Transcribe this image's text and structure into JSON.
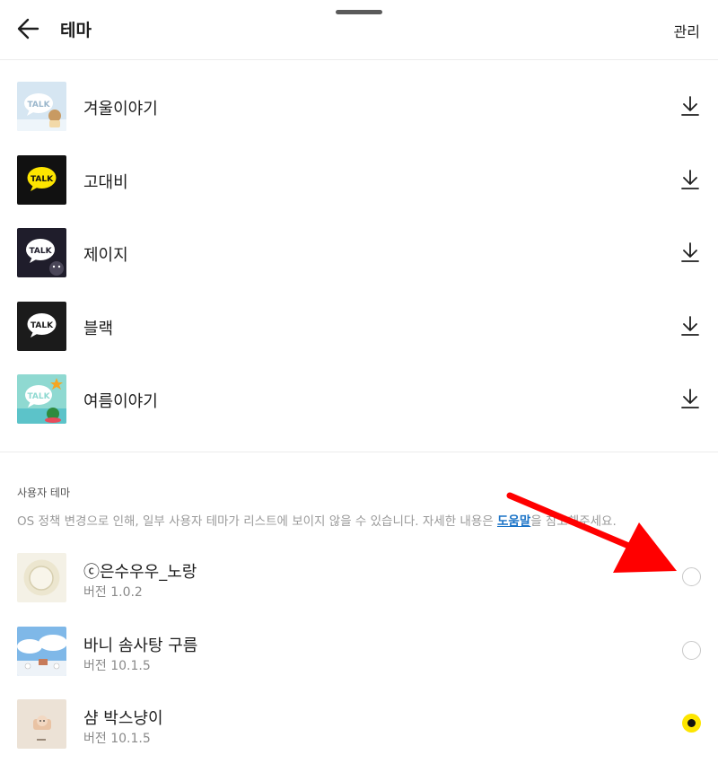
{
  "header": {
    "title": "테마",
    "manage_label": "관리"
  },
  "themes": [
    {
      "name": "겨울이야기",
      "thumb_label": "TALK",
      "style": "winter"
    },
    {
      "name": "고대비",
      "thumb_label": "TALK",
      "style": "highcontrast"
    },
    {
      "name": "제이지",
      "thumb_label": "TALK",
      "style": "jayg"
    },
    {
      "name": "블랙",
      "thumb_label": "TALK",
      "style": "black"
    },
    {
      "name": "여름이야기",
      "thumb_label": "TALK",
      "style": "summer"
    }
  ],
  "user_section": {
    "title": "사용자 테마",
    "notice_before": "OS 정책 변경으로 인해, 일부 사용자 테마가 리스트에 보이지 않을 수 있습니다. 자세한 내용은 ",
    "help_link": "도움말",
    "notice_after": "을 참고해주세요."
  },
  "user_themes": [
    {
      "name": "ⓒ은수우우_노랑",
      "version": "버전 1.0.2",
      "selected": false
    },
    {
      "name": "바니 솜사탕 구름",
      "version": "버전 10.1.5",
      "selected": false
    },
    {
      "name": "샴 박스냥이",
      "version": "버전 10.1.5",
      "selected": true
    }
  ],
  "colors": {
    "accent": "#fde500",
    "link": "#1a73c7",
    "annotation": "#ff0000"
  }
}
